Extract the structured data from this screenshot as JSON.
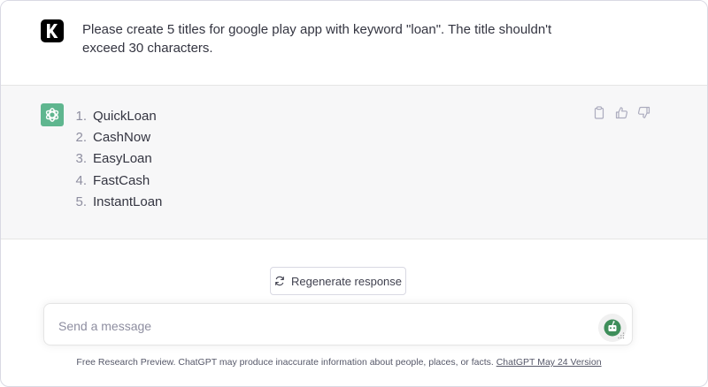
{
  "user_message": {
    "avatar_letter": "K",
    "text": "Please create 5 titles for google play app with keyword \"loan\". The title shouldn't exceed 30 characters."
  },
  "assistant_message": {
    "items": [
      {
        "num": "1.",
        "text": "QuickLoan"
      },
      {
        "num": "2.",
        "text": "CashNow"
      },
      {
        "num": "3.",
        "text": "EasyLoan"
      },
      {
        "num": "4.",
        "text": "FastCash"
      },
      {
        "num": "5.",
        "text": "InstantLoan"
      }
    ],
    "actions": [
      "copy-icon",
      "thumbs-up-icon",
      "thumbs-down-icon"
    ]
  },
  "regenerate": {
    "label": "Regenerate response",
    "icon": "refresh-icon"
  },
  "composer": {
    "placeholder": "Send a message",
    "value": ""
  },
  "footer": {
    "text": "Free Research Preview. ChatGPT may produce inaccurate information about people, places, or facts. ",
    "link": "ChatGPT May 24 Version"
  },
  "colors": {
    "assistant_avatar": "#5fb68f",
    "assistant_bg": "#f7f7f8",
    "user_avatar": "#000000"
  }
}
